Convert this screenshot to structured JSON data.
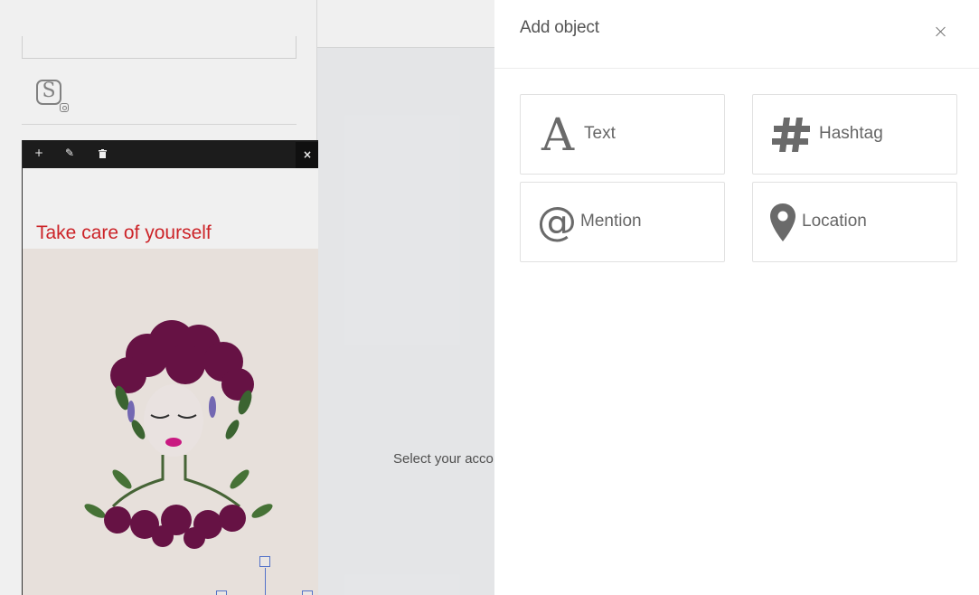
{
  "modal": {
    "title": "Add object",
    "options": [
      {
        "label": "Text",
        "icon": "letter-a-icon"
      },
      {
        "label": "Hashtag",
        "icon": "hashtag-icon"
      },
      {
        "label": "Mention",
        "icon": "at-sign-icon"
      },
      {
        "label": "Location",
        "icon": "map-pin-icon"
      }
    ]
  },
  "editor": {
    "caption": "Take care of yourself",
    "toolbar": {
      "add": "+",
      "edit": "✎",
      "delete": "🗑",
      "close": "×"
    }
  },
  "main": {
    "select_message": "Select your acco"
  },
  "colors": {
    "caption": "#d9262b",
    "icon": "#6a6a6a",
    "toolbar": "#1e1e1e"
  }
}
